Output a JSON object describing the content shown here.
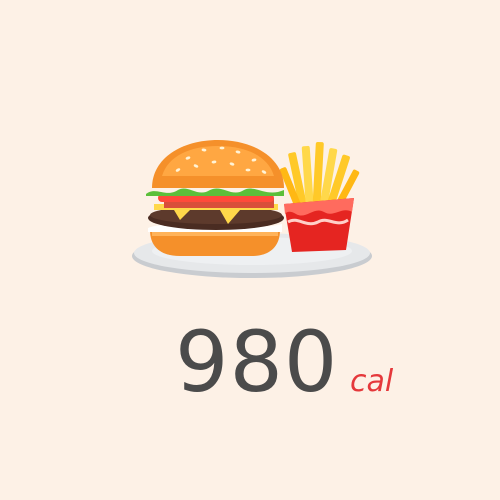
{
  "meal": {
    "icon": "burger-and-fries-icon",
    "calories_value": "980",
    "calories_unit": "cal"
  },
  "colors": {
    "background": "#fdf1e6",
    "value_text": "#4b4b4b",
    "unit_text": "#e5383b",
    "bun": "#f5902a",
    "fries": "#ffc928",
    "fries_box": "#e52521",
    "plate": "#e6e8ea"
  }
}
